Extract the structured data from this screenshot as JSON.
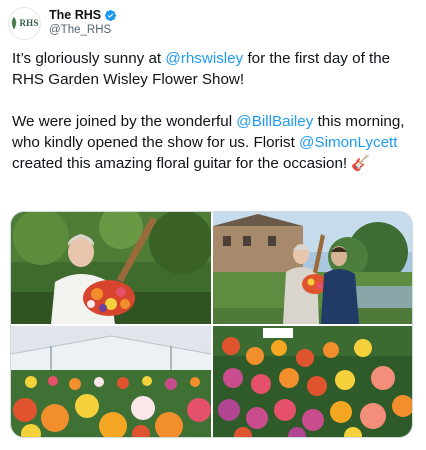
{
  "account": {
    "display_name": "The RHS",
    "handle": "@The_RHS",
    "avatar_text": "RHS",
    "verified_icon": "verified-badge-icon",
    "brand_color": "#1d9bf0"
  },
  "tweet": {
    "para1": {
      "t1": "It’s gloriously sunny at ",
      "m1": "@rhswisley",
      "t2": " for the first day of the RHS Garden Wisley Flower Show!"
    },
    "para2": {
      "t1": "We were joined by the wonderful ",
      "m1": "@BillBailey",
      "t2": " this morning, who kindly opened the show for us. Florist ",
      "m2": "@SimonLycett",
      "t3": " created this amazing floral guitar for the occasion! ",
      "emoji": "🎸"
    }
  },
  "media": [
    {
      "name": "photo-man-with-floral-guitar"
    },
    {
      "name": "photo-two-men-by-canal"
    },
    {
      "name": "photo-marquee-dahlias"
    },
    {
      "name": "photo-flower-display"
    }
  ]
}
